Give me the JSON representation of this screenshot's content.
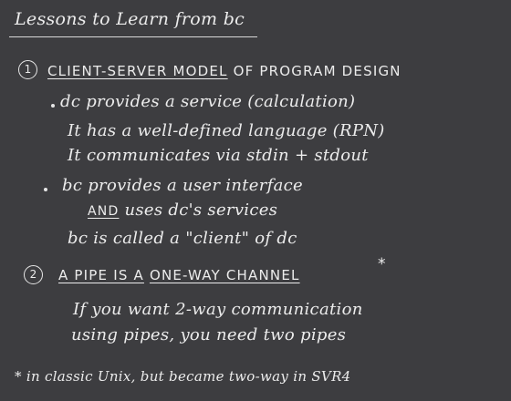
{
  "title": "Lessons to Learn from bc",
  "point1": {
    "number": "1",
    "heading_underlined": "CLIENT-SERVER MODEL",
    "heading_rest": "OF PROGRAM DESIGN",
    "dc": {
      "line1": "dc provides a service (calculation)",
      "line2": "It has a well-defined language (RPN)",
      "line3": "It communicates via stdin + stdout"
    },
    "bc": {
      "line1": "bc provides a user interface",
      "and_word": "AND",
      "line2_rest": "uses dc's services",
      "line3": "bc is called a \"client\" of dc"
    }
  },
  "point2": {
    "number": "2",
    "heading_prefix": "A PIPE IS A",
    "heading_underlined": "ONE-WAY CHANNEL",
    "star": "*",
    "line1": "If you want 2-way communication",
    "line2": "using pipes, you need two pipes"
  },
  "footnote": "* in classic Unix, but became two-way in SVR4"
}
